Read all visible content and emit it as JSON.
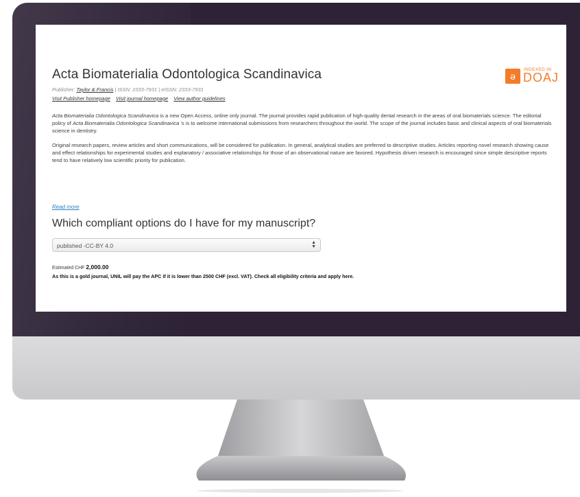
{
  "journal": {
    "title": "Acta Biomaterialia Odontologica Scandinavica",
    "publisher_prefix": "Publisher: ",
    "publisher_name": "Taylor & Francis",
    "issn_text": " | ISSN: 2333-7931 | eISSN: 2333-7931",
    "links": [
      "Visit Publisher homepage",
      "Visit journal homepage",
      "View author guidelines"
    ],
    "para1_title": "Acta Biomaterialia Odontologica Scandinavica",
    "para1_a": " is a new Open Access, online only journal. The journal provides rapid publication of high-quality dental research in the areas of oral biomaterials science. The editorial policy of ",
    "para1_title2": "Acta Biomaterialia Odontologica Scandinavica",
    "para1_b": " 's is to welcome international submissions from researchers throughout the world. The scope of the journal includes basic and clinical aspects of oral biomaterials science in dentistry.",
    "para2": "Original research papers, review articles and short communications, will be considered for publication. In general, analytical studies are preferred to descriptive studies. Articles reporting novel research showing cause and effect relationships for experimental studies and explanatory / associative relationships for those of an observational nature are favored. Hypothesis driven research is encouraged since simple descriptive reports tend to have relatively low scientific priority for publication.",
    "read_more": "Read more"
  },
  "doaj": {
    "indexed_in": "INDEXED IN",
    "name": "DOAJ",
    "icon": "open-access-icon",
    "color": "#f47b2a"
  },
  "options": {
    "heading": "Which compliant options do I have for my manuscript?",
    "selected": "published -CC-BY 4.0",
    "estimate_label": "Estimated CHF ",
    "estimate_value": "2,000.00",
    "apc_note": "As this is a gold journal, UNIL will pay the APC if it is lower than 2500 CHF (excl. VAT). Check all eligibility criteria and apply here."
  },
  "colors": {
    "bezel": "#2d2236",
    "link": "#2a7fc4",
    "accent": "#f47b2a"
  }
}
